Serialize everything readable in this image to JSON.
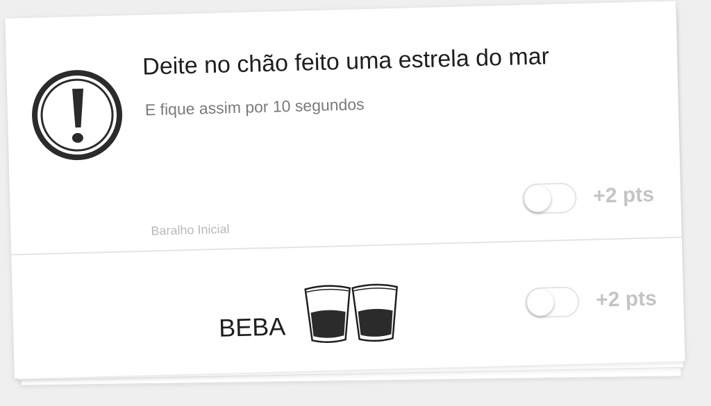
{
  "card": {
    "title": "Deite no chão feito uma estrela do mar",
    "subtitle": "E fique assim por 10 segundos",
    "deck": "Baralho Inicial",
    "icon": "exclamation-circle-icon",
    "toggle_on": false,
    "points": "+2 pts"
  },
  "drink": {
    "label": "BEBA",
    "icon": "shot-glasses-icon",
    "toggle_on": false,
    "points": "+2 pts"
  },
  "colors": {
    "text": "#1e1e1e",
    "muted": "#7a7a7a",
    "points": "#c4c4c4",
    "icon": "#2b2b2b"
  }
}
